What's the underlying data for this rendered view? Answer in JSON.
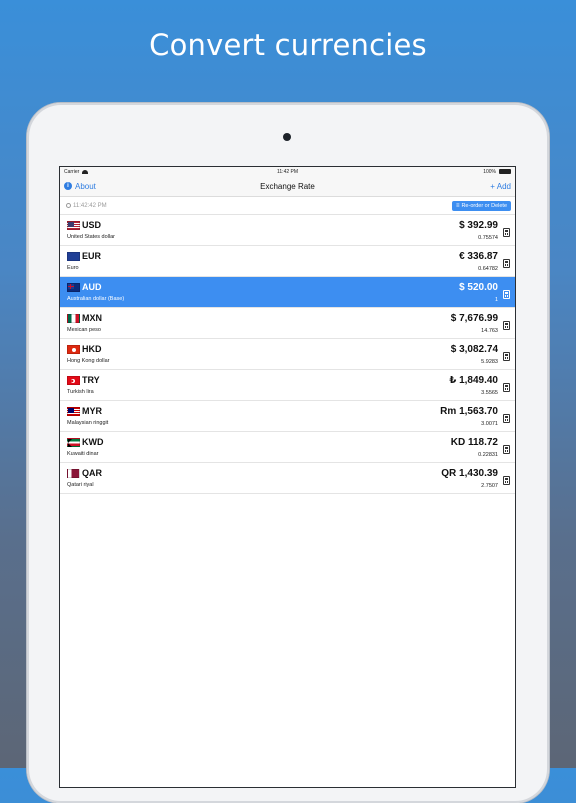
{
  "headline": "Convert currencies",
  "status_bar": {
    "carrier": "Carrier",
    "time": "11:42 PM",
    "battery": "100%"
  },
  "nav": {
    "about_label": "About",
    "title": "Exchange Rate",
    "add_label": "+ Add"
  },
  "toolbar": {
    "timestamp": "11:42:42 PM",
    "reorder_label": "Re-order or Delete"
  },
  "currencies": [
    {
      "code": "USD",
      "name": "United States dollar",
      "amount": "$ 392.99",
      "rate": "0.75574",
      "flag": "usd-flag"
    },
    {
      "code": "EUR",
      "name": "Euro",
      "amount": "€ 336.87",
      "rate": "0.64782",
      "flag": "eur-flag"
    },
    {
      "code": "AUD",
      "name": "Australian dollar (Base)",
      "amount": "$ 520.00",
      "rate": "1",
      "flag": "aud-flag",
      "base": true
    },
    {
      "code": "MXN",
      "name": "Mexican peso",
      "amount": "$ 7,676.99",
      "rate": "14.763",
      "flag": "mxn-flag"
    },
    {
      "code": "HKD",
      "name": "Hong Kong dollar",
      "amount": "$ 3,082.74",
      "rate": "5.9283",
      "flag": "hkd-flag"
    },
    {
      "code": "TRY",
      "name": "Turkish lira",
      "amount": "₺ 1,849.40",
      "rate": "3.5565",
      "flag": "try-flag"
    },
    {
      "code": "MYR",
      "name": "Malaysian ringgit",
      "amount": "Rm 1,563.70",
      "rate": "3.0071",
      "flag": "myr-flag"
    },
    {
      "code": "KWD",
      "name": "Kuwaiti dinar",
      "amount": "KD 118.72",
      "rate": "0.22831",
      "flag": "kwd-flag"
    },
    {
      "code": "QAR",
      "name": "Qatari riyal",
      "amount": "QR 1,430.39",
      "rate": "2.7507",
      "flag": "qar-flag"
    }
  ],
  "colors": {
    "accent": "#3d8ef1",
    "link": "#2f7de1"
  }
}
